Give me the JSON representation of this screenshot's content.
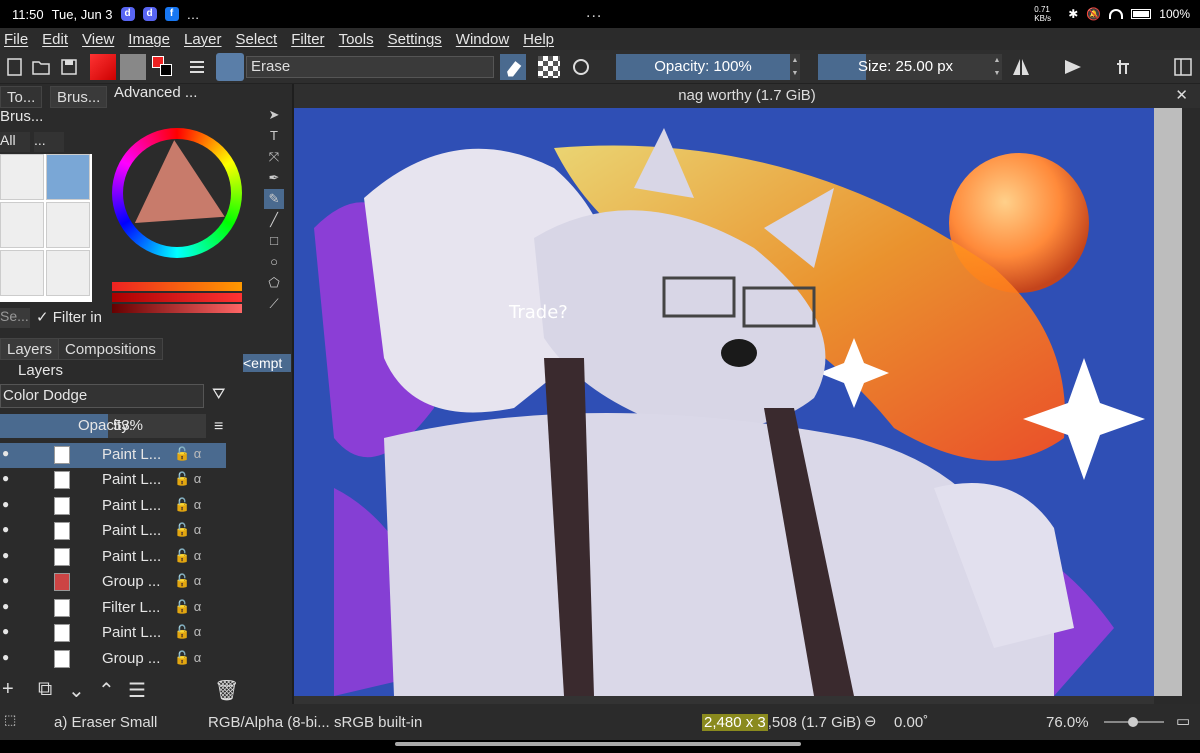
{
  "status": {
    "time": "11:50",
    "date": "Tue, Jun 3",
    "more_dots": "...",
    "network_speed": "0.71 KB/s",
    "battery": "100%"
  },
  "menu": [
    "File",
    "Edit",
    "View",
    "Image",
    "Layer",
    "Select",
    "Filter",
    "Tools",
    "Settings",
    "Window",
    "Help"
  ],
  "toolbar": {
    "brush_preset": "Erase",
    "opacity": "Opacity: 100%",
    "size": "Size: 25.00 px"
  },
  "left_panel": {
    "tabs": [
      "To...",
      "Brus...",
      "Advanced ..."
    ],
    "brush_dock_title": "Brus...",
    "brush_filter_all": "All",
    "brush_filter_tags": "...",
    "search_placeholder": "Se...",
    "filter_in": "Filter in"
  },
  "layers_panel": {
    "tabs": [
      "Layers",
      "Compositions"
    ],
    "title": "Layers",
    "blend_mode": "Color Dodge",
    "opacity_label": "Opacity:",
    "opacity_value": "53%",
    "empty_dock": "<empt",
    "layers": [
      {
        "name": "Paint L...",
        "selected": true
      },
      {
        "name": "Paint L..."
      },
      {
        "name": "Paint L..."
      },
      {
        "name": "Paint L..."
      },
      {
        "name": "Paint L..."
      },
      {
        "name": "Group ..."
      },
      {
        "name": "Filter L..."
      },
      {
        "name": "Paint L..."
      },
      {
        "name": "Group ..."
      }
    ]
  },
  "canvas": {
    "title": "nag worthy (1.7 GiB)",
    "annotation": "Trade?"
  },
  "bottom": {
    "brush": "a) Eraser Small",
    "color_model": "RGB/Alpha (8-bi...",
    "profile": "sRGB built-in",
    "dims_highlight": "2,480 x 3",
    "dims_rest": ",508 (1.7 GiB)",
    "rotation": "0.00˚",
    "zoom": "76.0%"
  },
  "colors": {
    "accent": "#4a6a8f",
    "canvas_bg": "#2f4fb5"
  }
}
